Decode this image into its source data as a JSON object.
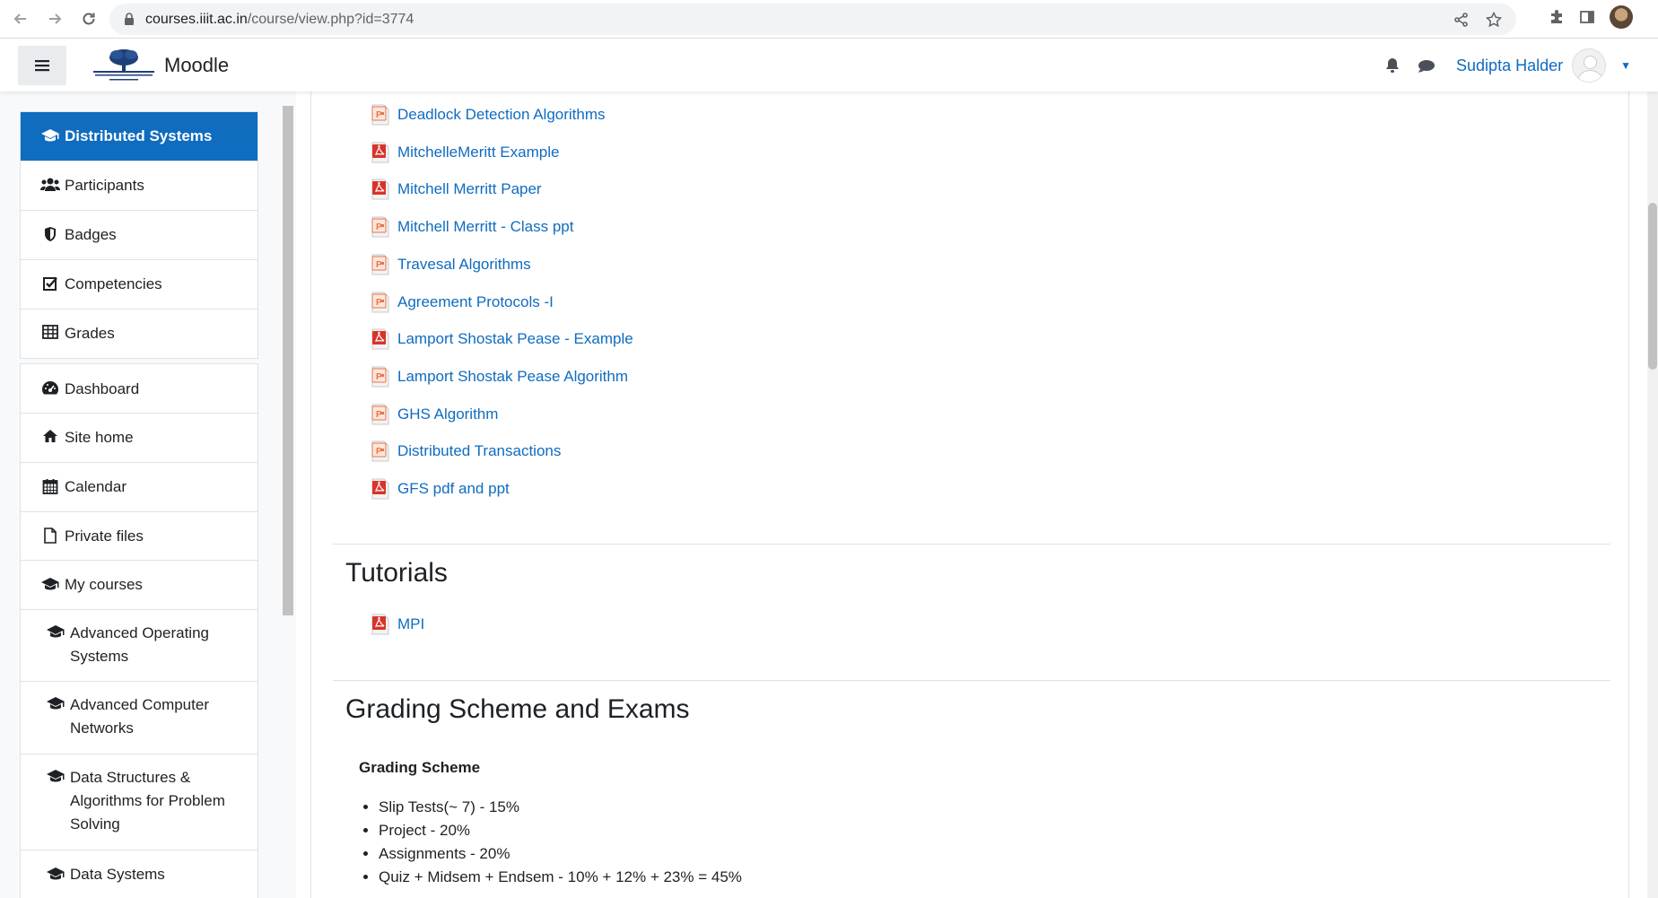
{
  "browser": {
    "url_host": "courses.iiit.ac.in",
    "url_path": "/course/view.php?id=3774"
  },
  "header": {
    "site_name": "Moodle",
    "user_name": "Sudipta Halder"
  },
  "sidebar": {
    "course_items": [
      {
        "label": "Distributed Systems",
        "icon": "graduation-cap-icon"
      },
      {
        "label": "Participants",
        "icon": "users-icon"
      },
      {
        "label": "Badges",
        "icon": "shield-icon"
      },
      {
        "label": "Competencies",
        "icon": "check-square-icon"
      },
      {
        "label": "Grades",
        "icon": "table-icon"
      }
    ],
    "site_items": [
      {
        "label": "Dashboard",
        "icon": "dashboard-icon"
      },
      {
        "label": "Site home",
        "icon": "home-icon"
      },
      {
        "label": "Calendar",
        "icon": "calendar-icon"
      },
      {
        "label": "Private files",
        "icon": "file-icon"
      },
      {
        "label": "My courses",
        "icon": "graduation-cap-icon"
      }
    ],
    "my_courses": [
      {
        "label": "Advanced Operating Systems"
      },
      {
        "label": "Advanced Computer Networks"
      },
      {
        "label": "Data Structures & Algorithms for Problem Solving"
      },
      {
        "label": "Data Systems"
      }
    ]
  },
  "main": {
    "activities": [
      {
        "label": "Deadlock Detection Algorithms",
        "type": "ppt"
      },
      {
        "label": "MitchelleMeritt Example",
        "type": "pdf"
      },
      {
        "label": "Mitchell Merritt Paper",
        "type": "pdf"
      },
      {
        "label": "Mitchell Merritt - Class ppt",
        "type": "ppt"
      },
      {
        "label": "Travesal Algorithms",
        "type": "ppt"
      },
      {
        "label": "Agreement Protocols -I",
        "type": "ppt"
      },
      {
        "label": "Lamport Shostak Pease - Example",
        "type": "pdf"
      },
      {
        "label": "Lamport Shostak Pease Algorithm",
        "type": "ppt"
      },
      {
        "label": "GHS Algorithm",
        "type": "ppt"
      },
      {
        "label": "Distributed Transactions",
        "type": "ppt"
      },
      {
        "label": "GFS pdf and ppt",
        "type": "pdf"
      }
    ],
    "tutorials": {
      "title": "Tutorials",
      "activities": [
        {
          "label": "MPI",
          "type": "pdf"
        }
      ]
    },
    "grading": {
      "title": "Grading Scheme and Exams",
      "heading": "Grading Scheme",
      "items": [
        "Slip Tests(~ 7) - 15%",
        "Project - 20%",
        "Assignments - 20%",
        "Quiz + Midsem + Endsem - 10% + 12% + 23% = 45%"
      ]
    }
  },
  "colors": {
    "link": "#0f6cbf",
    "active_bg": "#0f6cbf",
    "pdf_red": "#d9332a",
    "ppt_orange": "#e8734a"
  }
}
